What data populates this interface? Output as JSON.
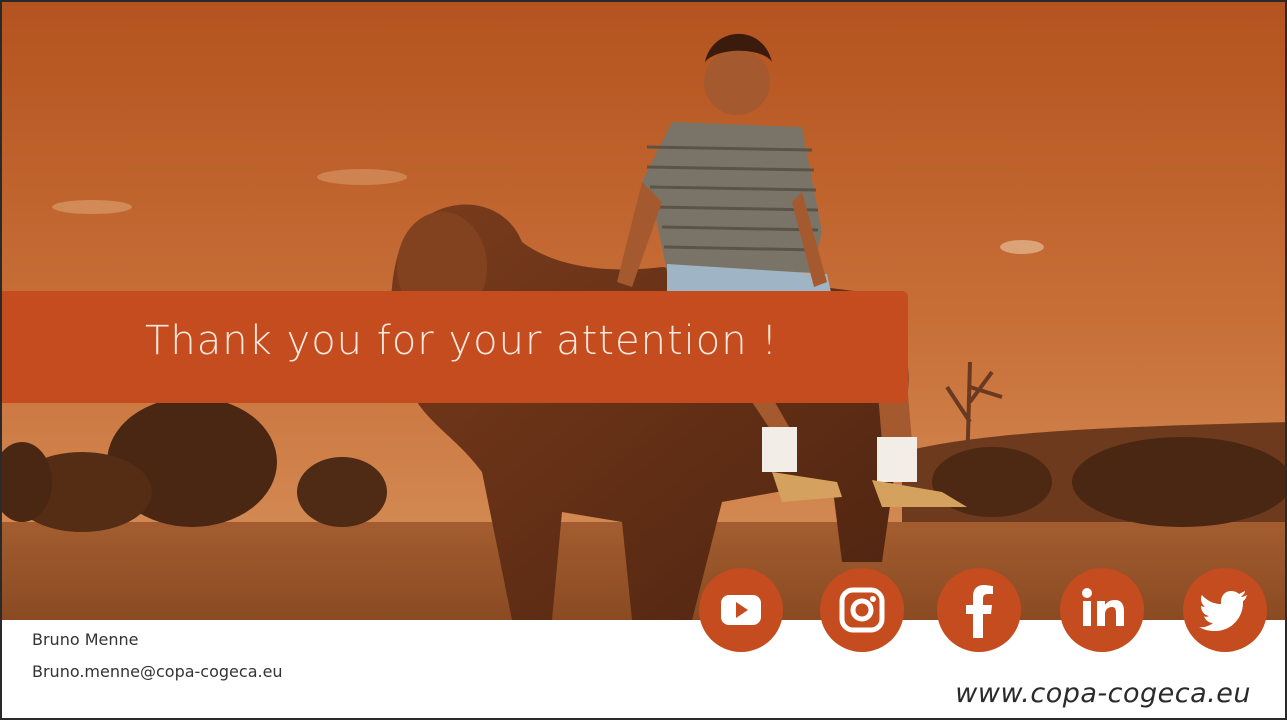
{
  "slide": {
    "headline": "Thank you for your attention !",
    "contact_name": "Bruno Menne",
    "contact_email": "Bruno.menne@copa-cogeca.eu",
    "website": "www.copa-cogeca.eu"
  },
  "social_icons": [
    "youtube-icon",
    "instagram-icon",
    "facebook-icon",
    "linkedin-icon",
    "twitter-icon"
  ],
  "colors": {
    "accent": "#c44c1e",
    "sky_top": "#b4531f",
    "sky_bottom": "#d38a55",
    "headline_text": "#fbe9df"
  }
}
